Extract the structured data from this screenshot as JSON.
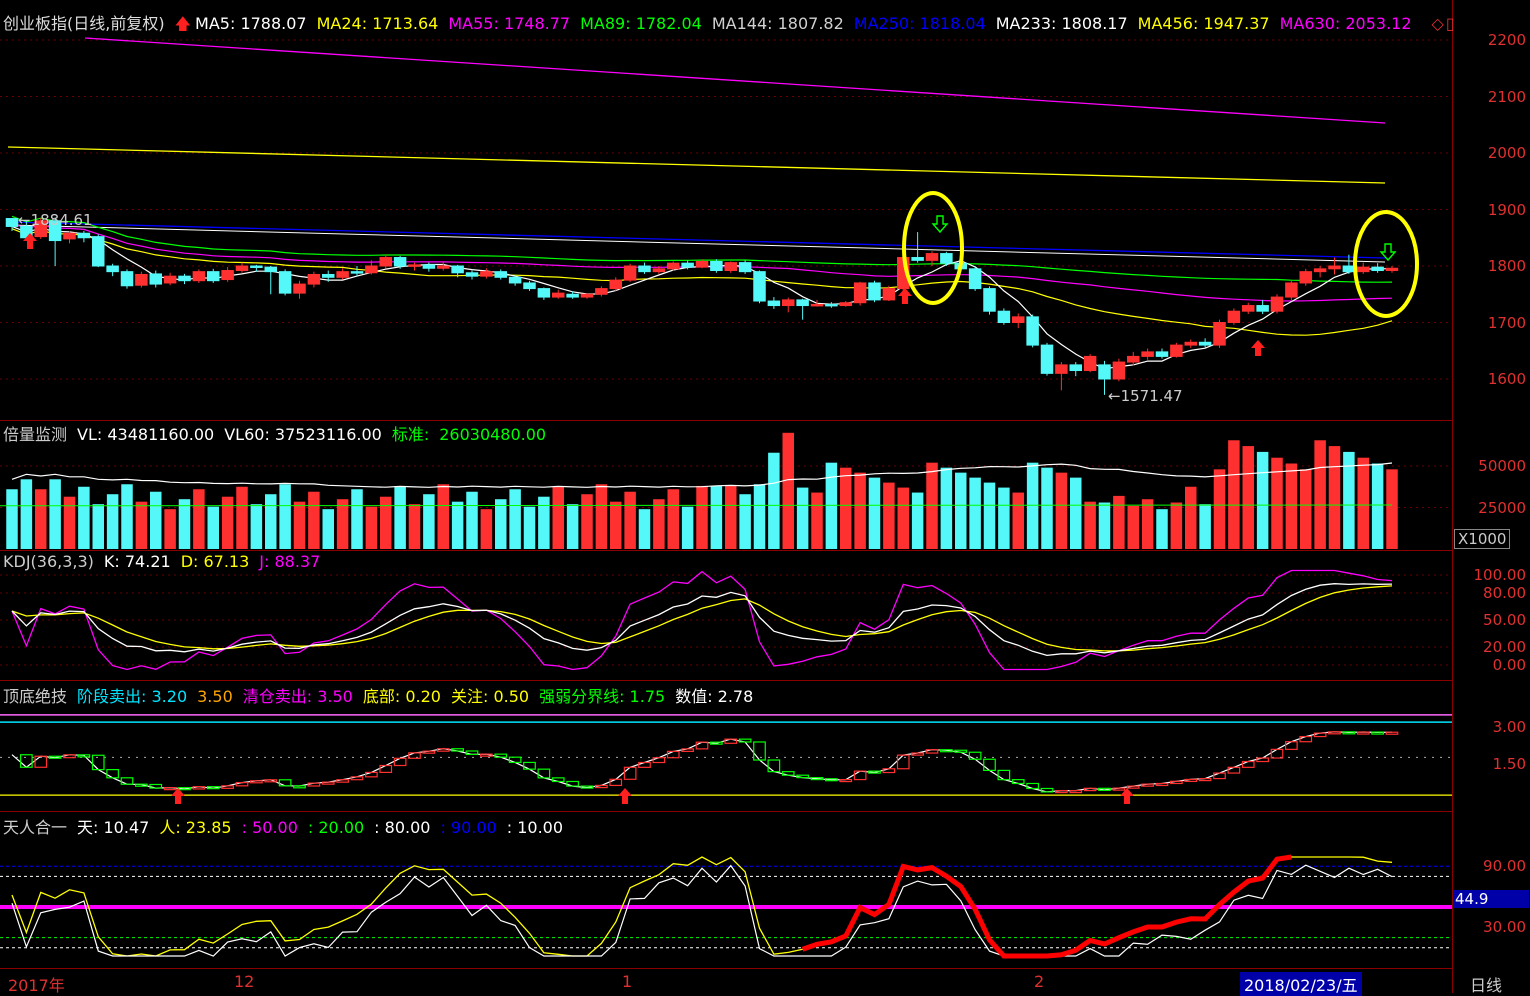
{
  "main": {
    "name": "创业板指(日线,前复权)",
    "ma": [
      {
        "label": "MA5: 1788.07",
        "color": "#ffffff"
      },
      {
        "label": "MA24: 1713.64",
        "color": "#ffff00"
      },
      {
        "label": "MA55: 1748.77",
        "color": "#ff00ff"
      },
      {
        "label": "MA89: 1782.04",
        "color": "#00ff00"
      },
      {
        "label": "MA144: 1807.82",
        "color": "#d0d0d0"
      },
      {
        "label": "MA250: 1818.04",
        "color": "#0000ff"
      },
      {
        "label": "MA233: 1808.17",
        "color": "#ffffff"
      },
      {
        "label": "MA456: 1947.37",
        "color": "#ffff00"
      },
      {
        "label": "MA630: 2053.12",
        "color": "#ff00ff"
      }
    ],
    "high_label": "1884.61",
    "low_label": "1571.47",
    "yticks": [
      "2200",
      "2100",
      "2000",
      "1900",
      "1800",
      "1700",
      "1600"
    ],
    "ohlc": [
      [
        1884,
        1870,
        1885,
        1862
      ],
      [
        1870,
        1850,
        1880,
        1846
      ],
      [
        1852,
        1880,
        1885,
        1848
      ],
      [
        1880,
        1845,
        1886,
        1800
      ],
      [
        1848,
        1858,
        1862,
        1840
      ],
      [
        1858,
        1850,
        1862,
        1842
      ],
      [
        1852,
        1800,
        1856,
        1798
      ],
      [
        1800,
        1790,
        1804,
        1782
      ],
      [
        1790,
        1765,
        1794,
        1760
      ],
      [
        1766,
        1785,
        1790,
        1762
      ],
      [
        1786,
        1768,
        1792,
        1762
      ],
      [
        1770,
        1782,
        1788,
        1766
      ],
      [
        1782,
        1774,
        1786,
        1768
      ],
      [
        1774,
        1790,
        1794,
        1770
      ],
      [
        1790,
        1774,
        1795,
        1770
      ],
      [
        1776,
        1792,
        1798,
        1772
      ],
      [
        1792,
        1800,
        1806,
        1788
      ],
      [
        1800,
        1798,
        1802,
        1790
      ],
      [
        1798,
        1790,
        1800,
        1750
      ],
      [
        1790,
        1752,
        1794,
        1748
      ],
      [
        1752,
        1768,
        1774,
        1742
      ],
      [
        1768,
        1785,
        1790,
        1762
      ],
      [
        1785,
        1780,
        1792,
        1772
      ],
      [
        1780,
        1790,
        1796,
        1776
      ],
      [
        1790,
        1788,
        1800,
        1782
      ],
      [
        1788,
        1800,
        1810,
        1785
      ],
      [
        1800,
        1815,
        1820,
        1796
      ],
      [
        1815,
        1800,
        1818,
        1795
      ],
      [
        1800,
        1802,
        1806,
        1792
      ],
      [
        1802,
        1796,
        1806,
        1790
      ],
      [
        1796,
        1800,
        1808,
        1792
      ],
      [
        1800,
        1788,
        1802,
        1780
      ],
      [
        1788,
        1782,
        1792,
        1776
      ],
      [
        1782,
        1790,
        1796,
        1778
      ],
      [
        1790,
        1780,
        1794,
        1776
      ],
      [
        1780,
        1770,
        1784,
        1765
      ],
      [
        1770,
        1760,
        1774,
        1756
      ],
      [
        1760,
        1745,
        1762,
        1740
      ],
      [
        1745,
        1752,
        1758,
        1742
      ],
      [
        1750,
        1745,
        1755,
        1742
      ],
      [
        1745,
        1750,
        1752,
        1742
      ],
      [
        1750,
        1760,
        1764,
        1746
      ],
      [
        1760,
        1775,
        1780,
        1756
      ],
      [
        1775,
        1800,
        1804,
        1772
      ],
      [
        1800,
        1790,
        1806,
        1786
      ],
      [
        1790,
        1795,
        1800,
        1786
      ],
      [
        1795,
        1805,
        1808,
        1792
      ],
      [
        1805,
        1798,
        1810,
        1794
      ],
      [
        1798,
        1808,
        1812,
        1796
      ],
      [
        1808,
        1792,
        1812,
        1788
      ],
      [
        1792,
        1806,
        1808,
        1788
      ],
      [
        1806,
        1790,
        1810,
        1786
      ],
      [
        1790,
        1738,
        1792,
        1734
      ],
      [
        1738,
        1730,
        1745,
        1724
      ],
      [
        1730,
        1740,
        1744,
        1718
      ],
      [
        1740,
        1730,
        1742,
        1705
      ],
      [
        1730,
        1732,
        1740,
        1728
      ],
      [
        1732,
        1730,
        1736,
        1726
      ],
      [
        1730,
        1735,
        1738,
        1728
      ],
      [
        1735,
        1770,
        1772,
        1730
      ],
      [
        1770,
        1740,
        1774,
        1736
      ],
      [
        1740,
        1760,
        1765,
        1738
      ],
      [
        1760,
        1815,
        1820,
        1756
      ],
      [
        1815,
        1810,
        1860,
        1806
      ],
      [
        1810,
        1822,
        1826,
        1800
      ],
      [
        1822,
        1805,
        1825,
        1800
      ],
      [
        1805,
        1795,
        1810,
        1790
      ],
      [
        1795,
        1760,
        1800,
        1756
      ],
      [
        1760,
        1720,
        1764,
        1714
      ],
      [
        1720,
        1700,
        1725,
        1696
      ],
      [
        1700,
        1710,
        1716,
        1690
      ],
      [
        1710,
        1660,
        1714,
        1656
      ],
      [
        1660,
        1610,
        1664,
        1606
      ],
      [
        1610,
        1625,
        1630,
        1580
      ],
      [
        1625,
        1615,
        1630,
        1605
      ],
      [
        1615,
        1640,
        1644,
        1612
      ],
      [
        1625,
        1600,
        1632,
        1572
      ],
      [
        1600,
        1630,
        1636,
        1596
      ],
      [
        1630,
        1640,
        1648,
        1624
      ],
      [
        1640,
        1648,
        1654,
        1634
      ],
      [
        1648,
        1640,
        1654,
        1636
      ],
      [
        1640,
        1660,
        1664,
        1638
      ],
      [
        1660,
        1665,
        1670,
        1655
      ],
      [
        1665,
        1660,
        1672,
        1656
      ],
      [
        1660,
        1700,
        1705,
        1655
      ],
      [
        1700,
        1720,
        1725,
        1696
      ],
      [
        1720,
        1730,
        1735,
        1715
      ],
      [
        1730,
        1720,
        1740,
        1715
      ],
      [
        1720,
        1745,
        1750,
        1716
      ],
      [
        1745,
        1770,
        1775,
        1740
      ],
      [
        1770,
        1790,
        1795,
        1765
      ],
      [
        1790,
        1795,
        1800,
        1780
      ],
      [
        1795,
        1800,
        1815,
        1785
      ],
      [
        1800,
        1790,
        1820,
        1786
      ],
      [
        1790,
        1798,
        1806,
        1786
      ],
      [
        1798,
        1792,
        1805,
        1788
      ],
      [
        1792,
        1796,
        1800,
        1788
      ]
    ],
    "events": {
      "up": [
        1,
        45,
        66,
        66,
        80
      ],
      "down": [
        53,
        68
      ]
    }
  },
  "volume": {
    "name": "倍量监测",
    "items": [
      {
        "label": "VL: 43481160.00",
        "color": "#ffffff"
      },
      {
        "label": "VL60: 37523116.00",
        "color": "#ffffff"
      },
      {
        "label": "标准:",
        "color": "#00ff00"
      },
      {
        "label": "26030480.00",
        "color": "#00ff00"
      }
    ],
    "yticks": [
      "50000",
      "25000"
    ],
    "unit": "X1000"
  },
  "kdj": {
    "name": "KDJ(36,3,3)",
    "items": [
      {
        "label": "K: 74.21",
        "color": "#ffffff"
      },
      {
        "label": "D: 67.13",
        "color": "#ffff00"
      },
      {
        "label": "J: 88.37",
        "color": "#ff00ff"
      }
    ],
    "yticks": [
      "100.00",
      "80.00",
      "50.00",
      "20.00",
      "0.00"
    ]
  },
  "ddj": {
    "name": "顶底绝技",
    "items": [
      {
        "label": "阶段卖出: 3.20",
        "color": "#00e5ff"
      },
      {
        "label": "3.50",
        "color": "#ffa500"
      },
      {
        "label": "清仓卖出: 3.50",
        "color": "#ff00ff"
      },
      {
        "label": "底部: 0.20",
        "color": "#ffff00"
      },
      {
        "label": "关注: 0.50",
        "color": "#ffff00"
      },
      {
        "label": "强弱分界线: 1.75",
        "color": "#00ff00"
      },
      {
        "label": "数值: 2.78",
        "color": "#ffffff"
      }
    ],
    "yticks": [
      "3.00",
      "1.50"
    ]
  },
  "trhy": {
    "name": "天人合一",
    "items": [
      {
        "label": "天: 10.47",
        "color": "#ffffff"
      },
      {
        "label": "人: 23.85",
        "color": "#ffff00"
      },
      {
        "label": ": 50.00",
        "color": "#ff00ff"
      },
      {
        "label": ": 20.00",
        "color": "#00ff00"
      },
      {
        "label": ": 80.00",
        "color": "#ffffff"
      },
      {
        "label": ": 90.00",
        "color": "#0000ff"
      },
      {
        "label": ": 10.00",
        "color": "#ffffff"
      }
    ],
    "yticks": [
      "90.00",
      "30.00"
    ],
    "badge": "44.9"
  },
  "xaxis": {
    "labels": [
      "2017年",
      "12",
      "1",
      "2"
    ],
    "date_badge": "2018/02/23/五",
    "period": "日线"
  }
}
